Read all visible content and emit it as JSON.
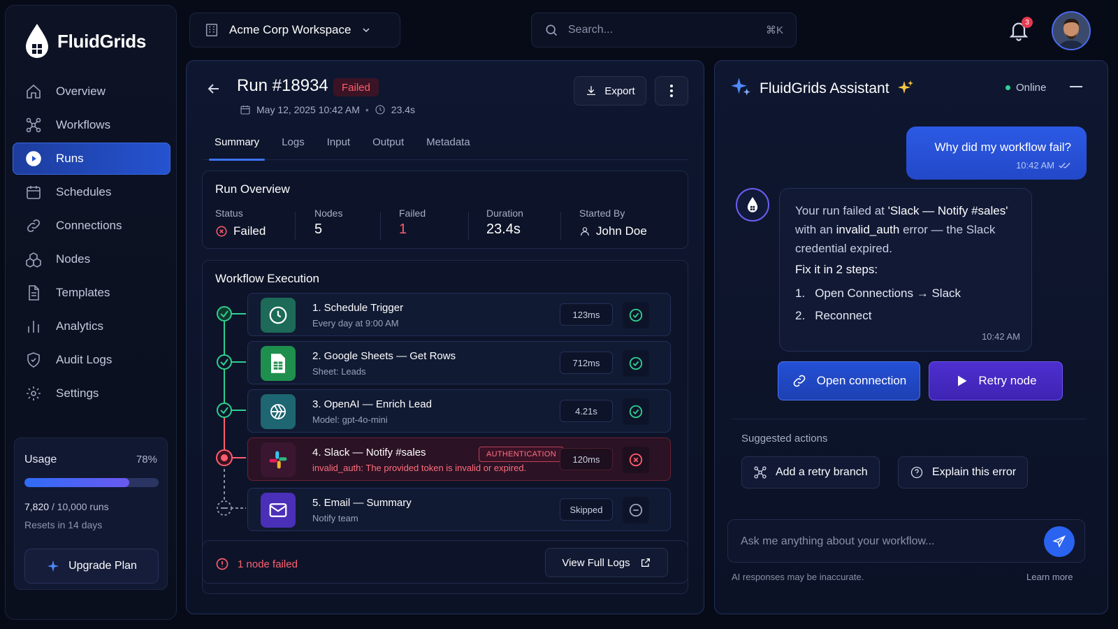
{
  "brand": {
    "name": "FluidGrids"
  },
  "sidebar": {
    "items": [
      {
        "label": "Overview",
        "icon": "home-icon",
        "active": false
      },
      {
        "label": "Workflows",
        "icon": "workflow-icon",
        "active": false
      },
      {
        "label": "Runs",
        "icon": "play-circle-icon",
        "active": true
      },
      {
        "label": "Schedules",
        "icon": "calendar-icon",
        "active": false
      },
      {
        "label": "Connections",
        "icon": "link-icon",
        "active": false
      },
      {
        "label": "Nodes",
        "icon": "cubes-icon",
        "active": false
      },
      {
        "label": "Templates",
        "icon": "document-icon",
        "active": false
      },
      {
        "label": "Analytics",
        "icon": "bar-chart-icon",
        "active": false
      },
      {
        "label": "Audit Logs",
        "icon": "shield-icon",
        "active": false
      },
      {
        "label": "Settings",
        "icon": "gear-icon",
        "active": false
      }
    ],
    "usage": {
      "title": "Usage",
      "percent_label": "78%",
      "fraction": 0.78,
      "used": "7,820",
      "limit_text": "/ 10,000 runs",
      "reset": "Resets in 14 days",
      "upgrade_label": "Upgrade Plan"
    }
  },
  "topbar": {
    "workspace": "Acme Corp Workspace",
    "search_placeholder": "Search...",
    "search_shortcut": "⌘K",
    "notification_count": "3"
  },
  "run": {
    "title": "Run #18934",
    "status_badge": "Failed",
    "date": "May 12, 2025 10:42 AM",
    "duration": "23.4s",
    "export_label": "Export",
    "tabs": [
      "Summary",
      "Logs",
      "Input",
      "Output",
      "Metadata"
    ],
    "overview": {
      "title": "Run Overview",
      "status_label": "Status",
      "status_value": "Failed",
      "nodes_label": "Nodes",
      "nodes_value": "5",
      "failed_label": "Failed",
      "failed_value": "1",
      "duration_label": "Duration",
      "duration_value": "23.4s",
      "started_label": "Started By",
      "started_value": "John Doe"
    },
    "execution": {
      "title": "Workflow Execution",
      "nodes": [
        {
          "title": "1. Schedule Trigger",
          "sub": "Every day at 9:00 AM",
          "time": "123ms",
          "status": "success",
          "icon": "clock-icon",
          "color": "#1d7a63"
        },
        {
          "title": "2. Google Sheets — Get Rows",
          "sub": "Sheet: Leads",
          "time": "712ms",
          "status": "success",
          "icon": "sheets-icon",
          "color": "#1f8f4e"
        },
        {
          "title": "3. OpenAI — Enrich Lead",
          "sub": "Model: gpt-4o-mini",
          "time": "4.21s",
          "status": "success",
          "icon": "openai-icon",
          "color": "#1f6f7a"
        },
        {
          "title": "4. Slack — Notify #sales",
          "sub": "invalid_auth: The provided token is invalid or expired.",
          "time": "120ms",
          "status": "error",
          "tag": "AUTHENTICATION",
          "icon": "slack-icon",
          "color": "#3a1630"
        },
        {
          "title": "5. Email — Summary",
          "sub": "Notify team",
          "time": "Skipped",
          "status": "skipped",
          "icon": "mail-icon",
          "color": "#4a2fb8"
        }
      ],
      "failed_note": "1 node failed",
      "view_logs_label": "View Full Logs"
    }
  },
  "assistant": {
    "title": "FluidGrids Assistant",
    "status": "Online",
    "user_message": "Why did my workflow fail?",
    "user_time": "10:42 AM",
    "bot": {
      "p1": "Your run failed at ",
      "p1_bold": "'Slack — Notify #sales'",
      "p2": " with an ",
      "p2_bold": "invalid_auth",
      "p3": " error — the Slack credential expired.",
      "fix_title": "Fix it in 2 steps:",
      "steps": [
        {
          "num": "1.",
          "text": "Open Connections → Slack"
        },
        {
          "num": "2.",
          "text": "Reconnect"
        }
      ],
      "time": "10:42 AM"
    },
    "open_connection_label": "Open connection",
    "retry_label": "Retry node",
    "suggested_label": "Suggested actions",
    "suggestions": [
      "Add a retry branch",
      "Explain this error"
    ],
    "input_placeholder": "Ask me anything about your workflow...",
    "disclaimer": "AI responses may be inaccurate.",
    "learn_more": "Learn more"
  },
  "colors": {
    "accent": "#2f6cf5",
    "success": "#2fcf8e",
    "error": "#ff5d6e",
    "purple": "#6b5df0"
  }
}
